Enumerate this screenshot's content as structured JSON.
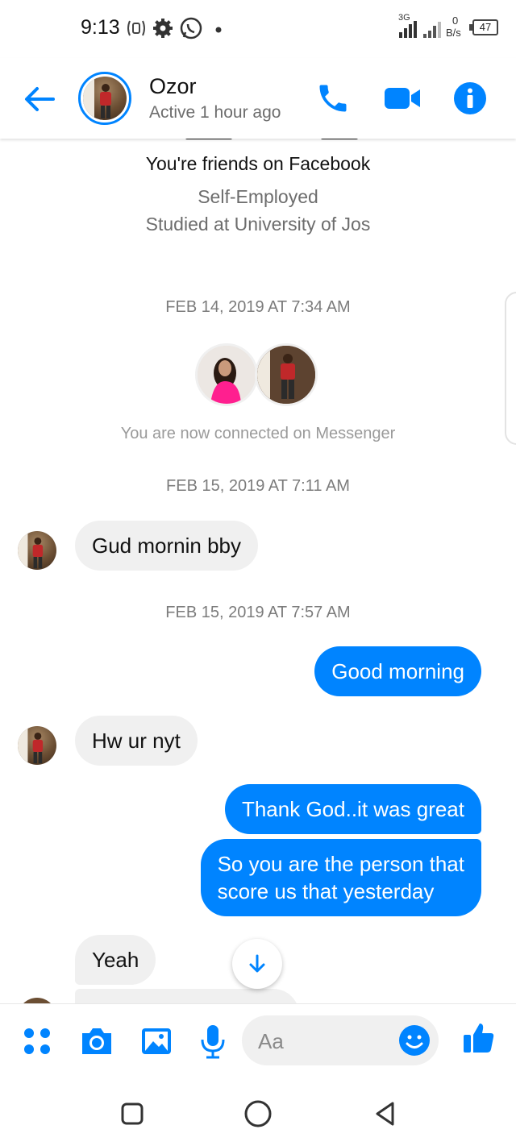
{
  "status_bar": {
    "time": "9:13",
    "network": "3G",
    "speed_value": "0",
    "speed_unit": "B/s",
    "battery": "47"
  },
  "header": {
    "name": "Ozor",
    "status": "Active 1 hour ago"
  },
  "profile": {
    "friends_text": "You're friends on Facebook",
    "work": "Self-Employed",
    "education": "Studied at University of Jos"
  },
  "timestamps": {
    "t1": "FEB 14, 2019 AT 7:34 AM",
    "t2": "FEB 15, 2019 AT 7:11 AM",
    "t3": "FEB 15, 2019 AT 7:57 AM"
  },
  "connected_text": "You are now connected on Messenger",
  "messages": [
    {
      "from": "them",
      "text": "Gud mornin bby"
    },
    {
      "from": "me",
      "text": "Good morning"
    },
    {
      "from": "them",
      "text": "Hw ur nyt"
    },
    {
      "from": "me",
      "text": "Thank God..it was great"
    },
    {
      "from": "me",
      "line1": "So you are the person that",
      "line2": "score us that yesterday"
    },
    {
      "from": "them",
      "text": "Yeah"
    }
  ],
  "composer": {
    "placeholder": "Aa"
  },
  "colors": {
    "accent": "#0084ff",
    "incoming_bubble": "#f0f0f0"
  },
  "icons": [
    "back-arrow-icon",
    "phone-icon",
    "video-camera-icon",
    "info-icon",
    "menu-dots-icon",
    "camera-icon",
    "gallery-icon",
    "microphone-icon",
    "emoji-icon",
    "like-icon",
    "scroll-down-icon",
    "square-nav-icon",
    "circle-nav-icon",
    "triangle-nav-icon"
  ]
}
